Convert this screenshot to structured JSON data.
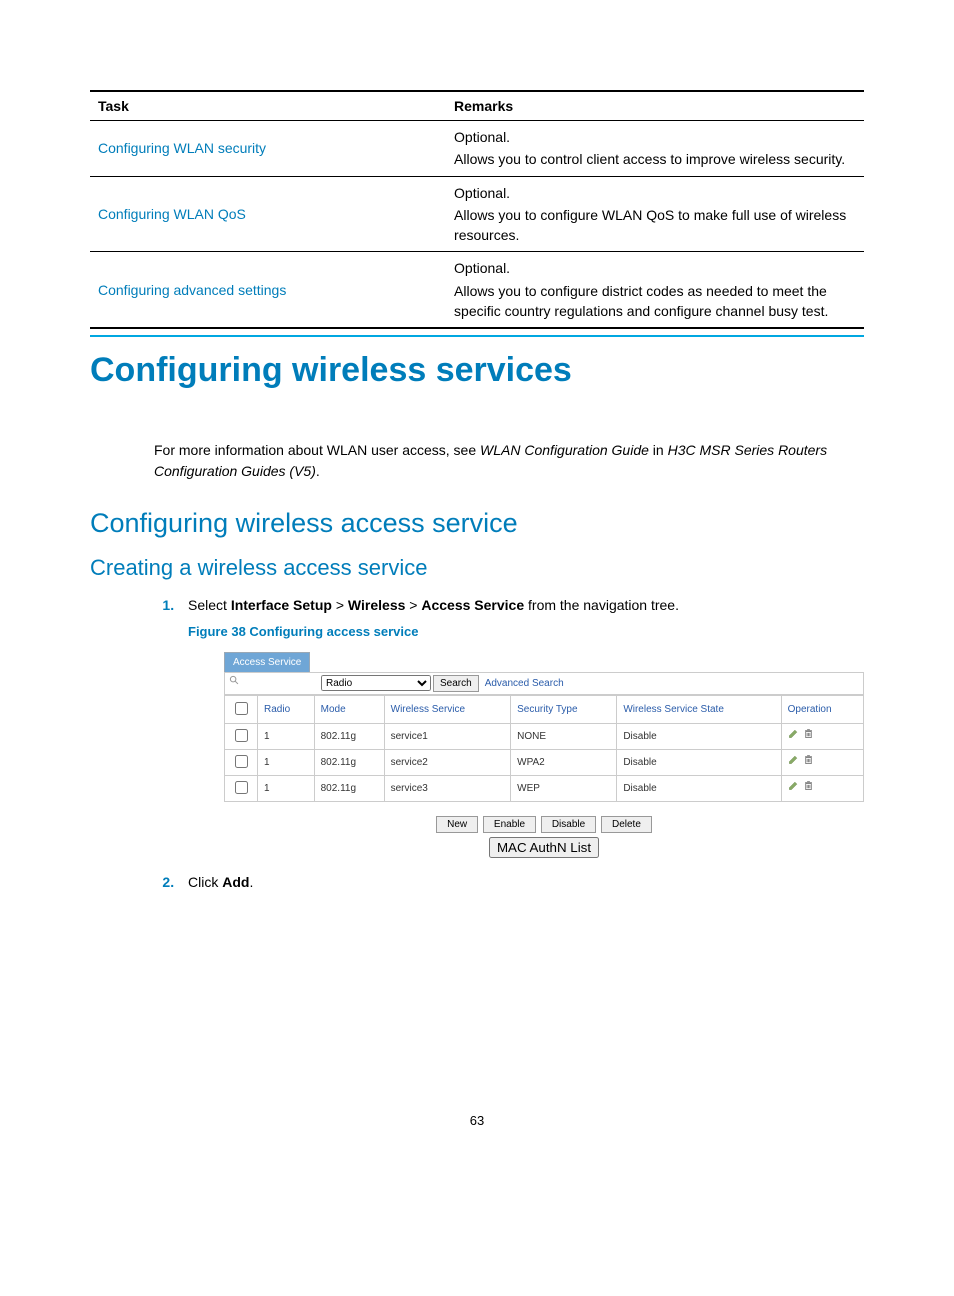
{
  "table": {
    "headers": {
      "task": "Task",
      "remarks": "Remarks"
    },
    "rows": [
      {
        "task": "Configuring WLAN security",
        "optional": "Optional.",
        "desc": "Allows you to control client access to improve wireless security."
      },
      {
        "task": "Configuring WLAN QoS",
        "optional": "Optional.",
        "desc": "Allows you to configure WLAN QoS to make full use of wireless resources."
      },
      {
        "task": "Configuring advanced settings",
        "optional": "Optional.",
        "desc": "Allows you to configure district codes as needed to meet the specific country regulations and configure channel busy test."
      }
    ]
  },
  "h1": "Configuring wireless services",
  "intro": {
    "pre": "For more information about WLAN user access, see ",
    "em1": "WLAN Configuration Guide",
    "mid": " in ",
    "em2": "H3C MSR Series Routers Configuration Guides (V5)",
    "post": "."
  },
  "h2": "Configuring wireless access service",
  "h3": "Creating a wireless access service",
  "step1": {
    "pre": "Select ",
    "b1": "Interface Setup",
    "gt1": " > ",
    "b2": "Wireless",
    "gt2": " > ",
    "b3": "Access Service",
    "post": " from the navigation tree."
  },
  "figcap": "Figure 38 Configuring access service",
  "ui": {
    "tab": "Access Service",
    "searchField": "Radio",
    "searchBtn": "Search",
    "advSearch": "Advanced Search",
    "cols": {
      "radio": "Radio",
      "mode": "Mode",
      "ws": "Wireless Service",
      "st": "Security Type",
      "wss": "Wireless Service State",
      "op": "Operation"
    },
    "rows": [
      {
        "radio": "1",
        "mode": "802.11g",
        "ws": "service1",
        "st": "NONE",
        "wss": "Disable"
      },
      {
        "radio": "1",
        "mode": "802.11g",
        "ws": "service2",
        "st": "WPA2",
        "wss": "Disable"
      },
      {
        "radio": "1",
        "mode": "802.11g",
        "ws": "service3",
        "st": "WEP",
        "wss": "Disable"
      }
    ],
    "actions": {
      "new": "New",
      "enable": "Enable",
      "disable": "Disable",
      "delete": "Delete",
      "mac": "MAC AuthN List"
    }
  },
  "step2": {
    "pre": "Click ",
    "b": "Add",
    "post": "."
  },
  "pagenum": "63"
}
